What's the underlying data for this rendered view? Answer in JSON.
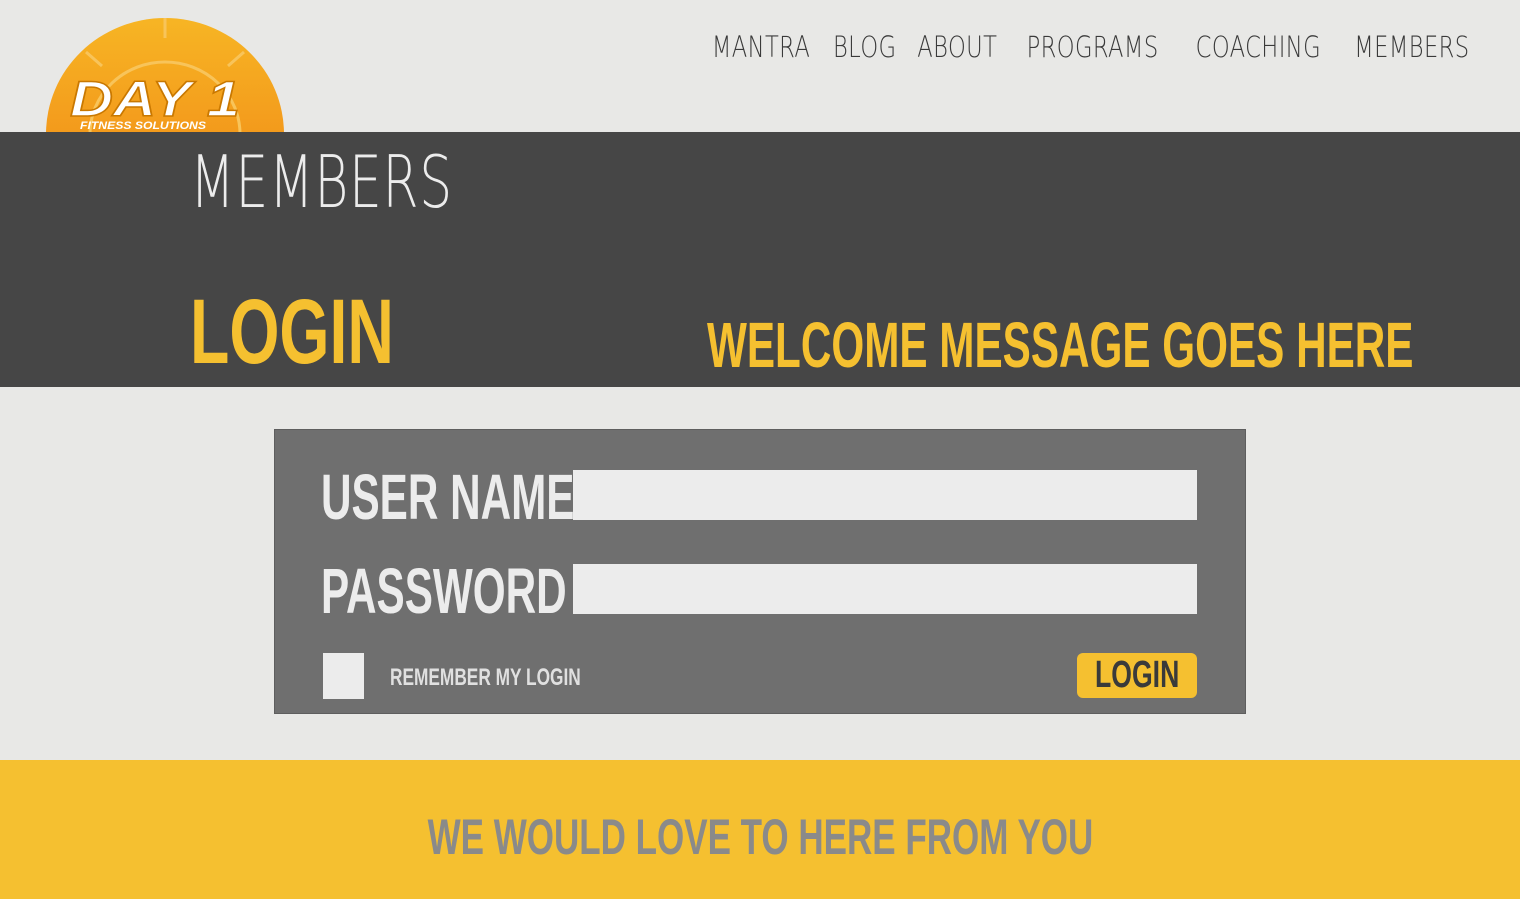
{
  "logo": {
    "main_text": "DAY 1",
    "tagline": "FITNESS SOLUTIONS"
  },
  "nav": {
    "items": [
      {
        "label": "MANTRA"
      },
      {
        "label": "BLOG"
      },
      {
        "label": "ABOUT"
      },
      {
        "label": "PROGRAMS"
      },
      {
        "label": "COACHING"
      },
      {
        "label": "MEMBERS"
      }
    ]
  },
  "banner": {
    "title": "MEMBERS",
    "login_heading": "LOGIN",
    "welcome_message": "WELCOME MESSAGE GOES HERE"
  },
  "login_form": {
    "username_label": "USER NAME",
    "username_value": "",
    "password_label": "PASSWORD",
    "password_value": "",
    "remember_label": "REMEMBER MY LOGIN",
    "remember_checked": false,
    "submit_label": "LOGIN"
  },
  "footer": {
    "text": "WE WOULD LOVE TO HERE FROM YOU"
  },
  "colors": {
    "accent": "#f5c030",
    "banner": "#464646",
    "panel": "#6f6f6f",
    "background": "#e8e8e6",
    "footer_text": "#8a8a8a"
  }
}
